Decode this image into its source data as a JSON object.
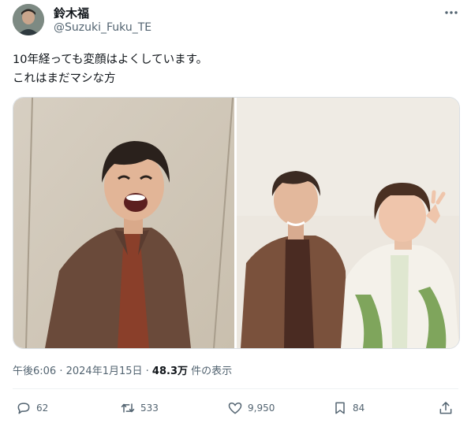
{
  "author": {
    "display_name": "鈴木福",
    "handle": "@Suzuki_Fuku_TE"
  },
  "post": {
    "text_line1": "10年経っても変顔はよくしています。",
    "text_line2": "これはまだマシな方"
  },
  "meta": {
    "time": "午後6:06",
    "separator": " · ",
    "date": "2024年1月15日",
    "views_count": "48.3万",
    "views_label": " 件の表示"
  },
  "actions": {
    "replies": "62",
    "reposts": "533",
    "likes": "9,950",
    "bookmarks": "84"
  },
  "icons": [
    "more-icon",
    "reply-icon",
    "repost-icon",
    "like-icon",
    "bookmark-icon",
    "share-icon"
  ],
  "colors": {
    "text": "#0f1419",
    "secondary": "#536471",
    "border": "#eff3f4"
  }
}
